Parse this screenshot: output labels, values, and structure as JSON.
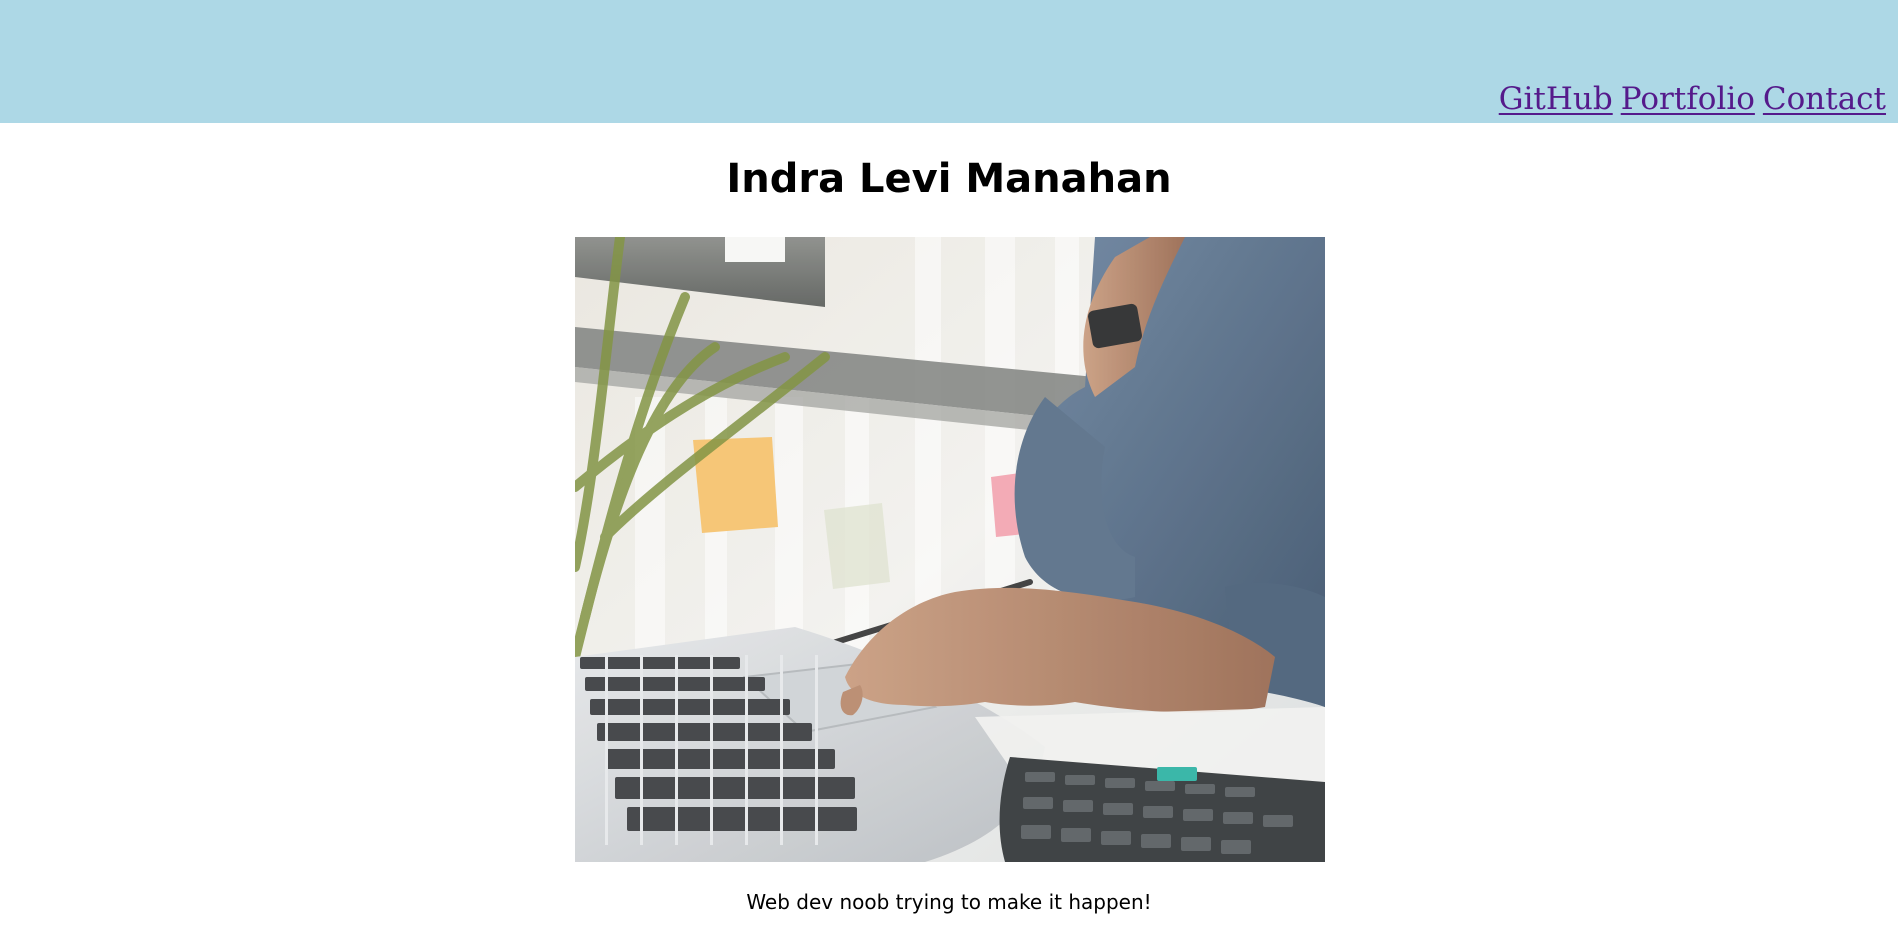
{
  "nav": {
    "links": [
      {
        "label": "GitHub"
      },
      {
        "label": "Portfolio"
      },
      {
        "label": "Contact"
      }
    ]
  },
  "header": {
    "title": "Indra Levi Manahan"
  },
  "hero_image": {
    "subject": "laptop-workspace-photo"
  },
  "caption": "Web dev noob trying to make it happen!",
  "colors": {
    "topbar": "#add8e6",
    "link": "#551a8b",
    "text": "#000000"
  }
}
